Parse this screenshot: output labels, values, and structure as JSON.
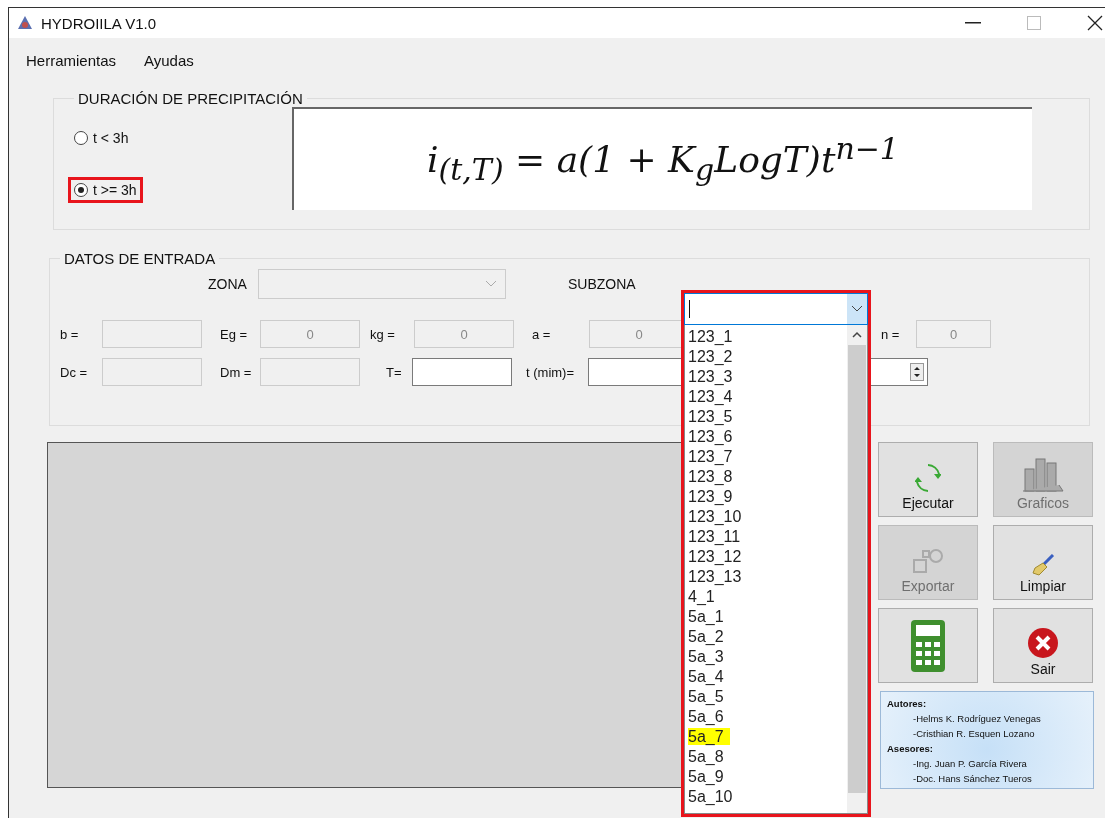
{
  "window": {
    "title": "HYDROIILA V1.0"
  },
  "menu": [
    "Herramientas",
    "Ayudas"
  ],
  "duration": {
    "title": "DURACIÓN DE PRECIPITACIÓN",
    "options": [
      {
        "label": "t < 3h",
        "selected": false,
        "highlighted": false
      },
      {
        "label": "t >= 3h",
        "selected": true,
        "highlighted": true
      }
    ],
    "formula": "i$_{(t,T)}$ = a(1 + K$_{g}$LogT)t$^{n−1}$"
  },
  "inputs": {
    "title": "DATOS DE ENTRADA",
    "zona": {
      "label": "ZONA",
      "disabled": true
    },
    "subzona": {
      "label": "SUBZONA",
      "expanded": true,
      "highlighted": true,
      "options": [
        {
          "label": "123_1",
          "highlighted": false
        },
        {
          "label": "123_2",
          "highlighted": false
        },
        {
          "label": "123_3",
          "highlighted": false
        },
        {
          "label": "123_4",
          "highlighted": false
        },
        {
          "label": "123_5",
          "highlighted": false
        },
        {
          "label": "123_6",
          "highlighted": false
        },
        {
          "label": "123_7",
          "highlighted": false
        },
        {
          "label": "123_8",
          "highlighted": false
        },
        {
          "label": "123_9",
          "highlighted": false
        },
        {
          "label": "123_10",
          "highlighted": false
        },
        {
          "label": "123_11",
          "highlighted": false
        },
        {
          "label": "123_12",
          "highlighted": false
        },
        {
          "label": "123_13",
          "highlighted": false
        },
        {
          "label": "4_1",
          "highlighted": false
        },
        {
          "label": "5a_1",
          "highlighted": false
        },
        {
          "label": "5a_2",
          "highlighted": false
        },
        {
          "label": "5a_3",
          "highlighted": false
        },
        {
          "label": "5a_4",
          "highlighted": false
        },
        {
          "label": "5a_5",
          "highlighted": false
        },
        {
          "label": "5a_6",
          "highlighted": false
        },
        {
          "label": "5a_7",
          "highlighted": true
        },
        {
          "label": "5a_8",
          "highlighted": false
        },
        {
          "label": "5a_9",
          "highlighted": false
        },
        {
          "label": "5a_10",
          "highlighted": false
        }
      ]
    },
    "rows": [
      [
        {
          "kind": "text",
          "label": "b =",
          "disabled": true
        },
        {
          "kind": "text",
          "label": "Eg =",
          "value": "0",
          "disabled": true
        },
        {
          "kind": "text",
          "label": "kg =",
          "value": "0",
          "disabled": true
        },
        {
          "kind": "text",
          "label": "a =",
          "value": "0",
          "disabled": true
        },
        {
          "kind": "text",
          "label": "n =",
          "value": "0",
          "disabled": true
        }
      ],
      [
        {
          "kind": "text",
          "label": "Dc =",
          "disabled": true
        },
        {
          "kind": "text",
          "label": "Dm =",
          "disabled": true
        },
        {
          "kind": "text",
          "label": "T=",
          "disabled": false
        },
        {
          "kind": "text",
          "label": "t (mim)=",
          "disabled": false
        },
        {
          "kind": "spinner",
          "disabled": false
        }
      ]
    ]
  },
  "buttons": [
    {
      "kind": "run",
      "label": "Ejecutar",
      "disabled": false
    },
    {
      "kind": "chart",
      "label": "Graficos",
      "disabled": true
    },
    {
      "kind": "export",
      "label": "Exportar",
      "disabled": true
    },
    {
      "kind": "clean",
      "label": "Limpiar",
      "disabled": false
    },
    {
      "kind": "calculator",
      "disabled": false
    },
    {
      "kind": "exit",
      "label": "Sair",
      "disabled": false
    }
  ],
  "credits": [
    {
      "kind": "heading",
      "text": "Autores:"
    },
    {
      "kind": "name",
      "text": "-Helms K. Rodríguez Venegas"
    },
    {
      "kind": "name",
      "text": "-Cristhian R. Esquen Lozano"
    },
    {
      "kind": "heading",
      "text": "Asesores:"
    },
    {
      "kind": "name",
      "text": "-Ing. Juan P. García Rivera"
    },
    {
      "kind": "name",
      "text": "-Doc. Hans Sánchez Tueros"
    }
  ]
}
